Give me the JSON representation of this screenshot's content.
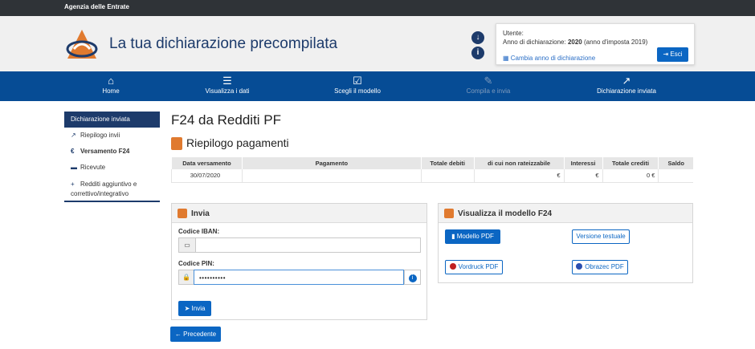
{
  "topbar": {
    "brand": "Agenzia delle Entrate"
  },
  "header": {
    "title": "La tua dichiarazione precompilata",
    "user_label": "Utente:",
    "year_prefix": "Anno di dichiarazione: ",
    "year": "2020",
    "year_suffix": " (anno d'imposta 2019)",
    "change_year": "Cambia anno di dichiarazione",
    "logout": "Esci"
  },
  "nav": {
    "items": [
      {
        "label": "Home",
        "icon": "home-icon"
      },
      {
        "label": "Visualizza i dati",
        "icon": "list-icon"
      },
      {
        "label": "Scegli il modello",
        "icon": "checkbox-icon"
      },
      {
        "label": "Compila e invia",
        "icon": "edit-icon"
      },
      {
        "label": "Dichiarazione inviata",
        "icon": "share-icon"
      }
    ]
  },
  "sidebar": {
    "title": "Dichiarazione inviata",
    "items": [
      {
        "label": "Riepilogo invii",
        "icon": "external-link-icon"
      },
      {
        "label": "Versamento F24",
        "icon": "euro-icon"
      },
      {
        "label": "Ricevute",
        "icon": "folder-icon"
      },
      {
        "label": "Redditi aggiuntivo e correttivo/integrativo",
        "icon": "plus-icon"
      }
    ]
  },
  "main": {
    "title": "F24 da Redditi PF",
    "subtitle": "Riepilogo pagamenti",
    "table": {
      "columns": [
        "Data versamento",
        "Pagamento",
        "Totale debiti",
        "di cui non rateizzabile",
        "Interessi",
        "Totale crediti",
        "Saldo"
      ],
      "rows": [
        [
          "30/07/2020",
          "",
          "",
          "€",
          "€",
          "0 €",
          ""
        ]
      ]
    }
  },
  "invia": {
    "title": "Invia",
    "iban_label": "Codice IBAN:",
    "iban_value": "",
    "pin_label": "Codice PIN:",
    "pin_value": "••••••••••",
    "send": "Invia"
  },
  "modello": {
    "title": "Visualizza il modello F24",
    "pdf": "Modello PDF",
    "text_version": "Versione testuale",
    "vordruck": "Vordruck PDF",
    "obrazec": "Obrazec PDF"
  },
  "footer": {
    "back": "Precedente"
  },
  "colors": {
    "primary": "#064c95",
    "accent": "#e07a2f",
    "button": "#0b66c3"
  }
}
